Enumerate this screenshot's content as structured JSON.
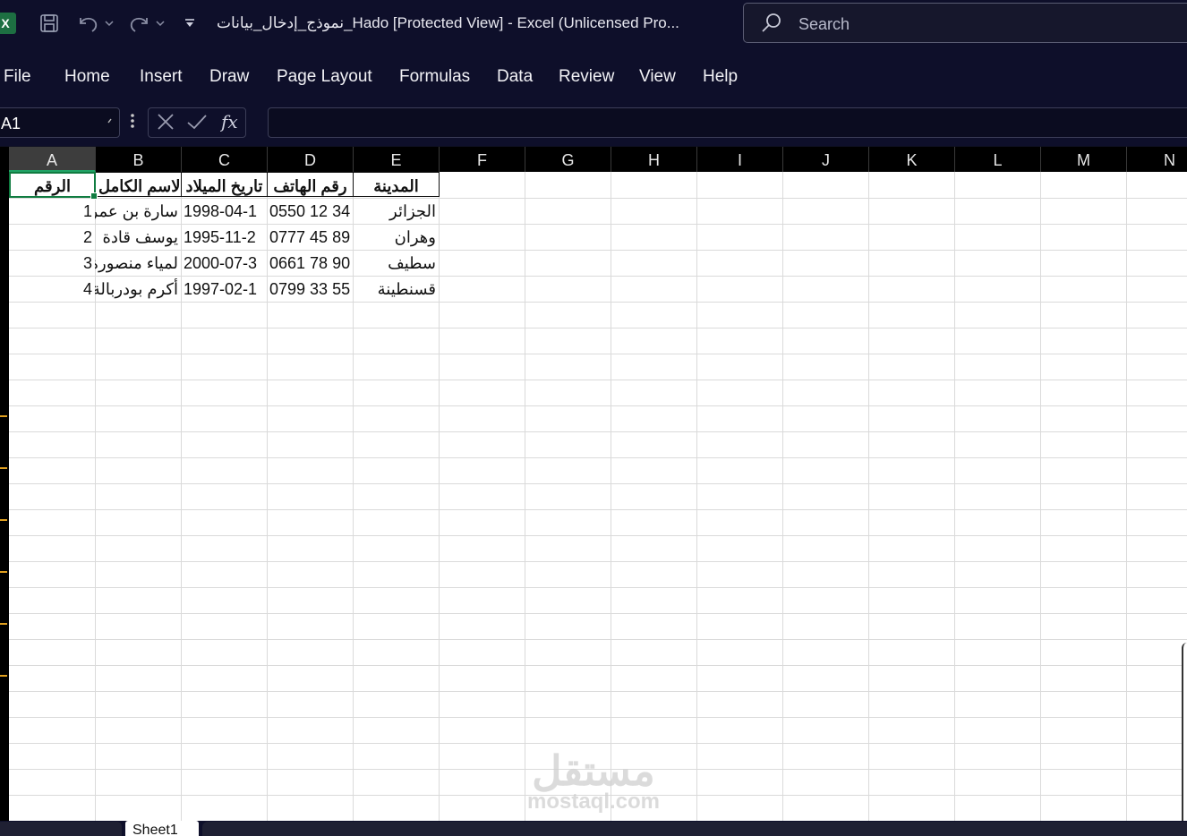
{
  "titlebar": {
    "app_icon": "X",
    "title": "نموذج_إدخال_بيانات_Hado  [Protected View]  -  Excel (Unlicensed Pro...",
    "search_placeholder": "Search",
    "icons": [
      "excel-icon",
      "save-icon",
      "undo-icon",
      "redo-icon",
      "customize-icon",
      "search-icon"
    ]
  },
  "menu": {
    "items": [
      "File",
      "Home",
      "Insert",
      "Draw",
      "Page Layout",
      "Formulas",
      "Data",
      "Review",
      "View",
      "Help"
    ]
  },
  "formula_bar": {
    "name_box": "A1",
    "formula": ""
  },
  "sheet": {
    "columns": [
      "A",
      "B",
      "C",
      "D",
      "E",
      "F",
      "G",
      "H",
      "I",
      "J",
      "K",
      "L",
      "M",
      "N"
    ],
    "selected_column": "A",
    "header": [
      "الرقم",
      "الاسم الكامل",
      "تاريخ الميلاد",
      "رقم الهاتف",
      "المدينة"
    ],
    "rows": [
      [
        "1",
        "سارة بن عمر",
        "1998-04-1",
        "0550 12 34",
        "الجزائر"
      ],
      [
        "2",
        "يوسف قادة",
        "1995-11-2",
        "0777 45 89",
        "وهران"
      ],
      [
        "3",
        "لمياء منصورة",
        "2000-07-3",
        "0661 78 90",
        "سطيف"
      ],
      [
        "4",
        "أكرم بودربالة",
        "1997-02-1",
        "0799 33 55",
        "قسنطينة"
      ]
    ]
  },
  "sheet_tabs": {
    "active": "Sheet1"
  },
  "watermark": {
    "arabic": "مستقل",
    "latin": "mostaql.com"
  }
}
